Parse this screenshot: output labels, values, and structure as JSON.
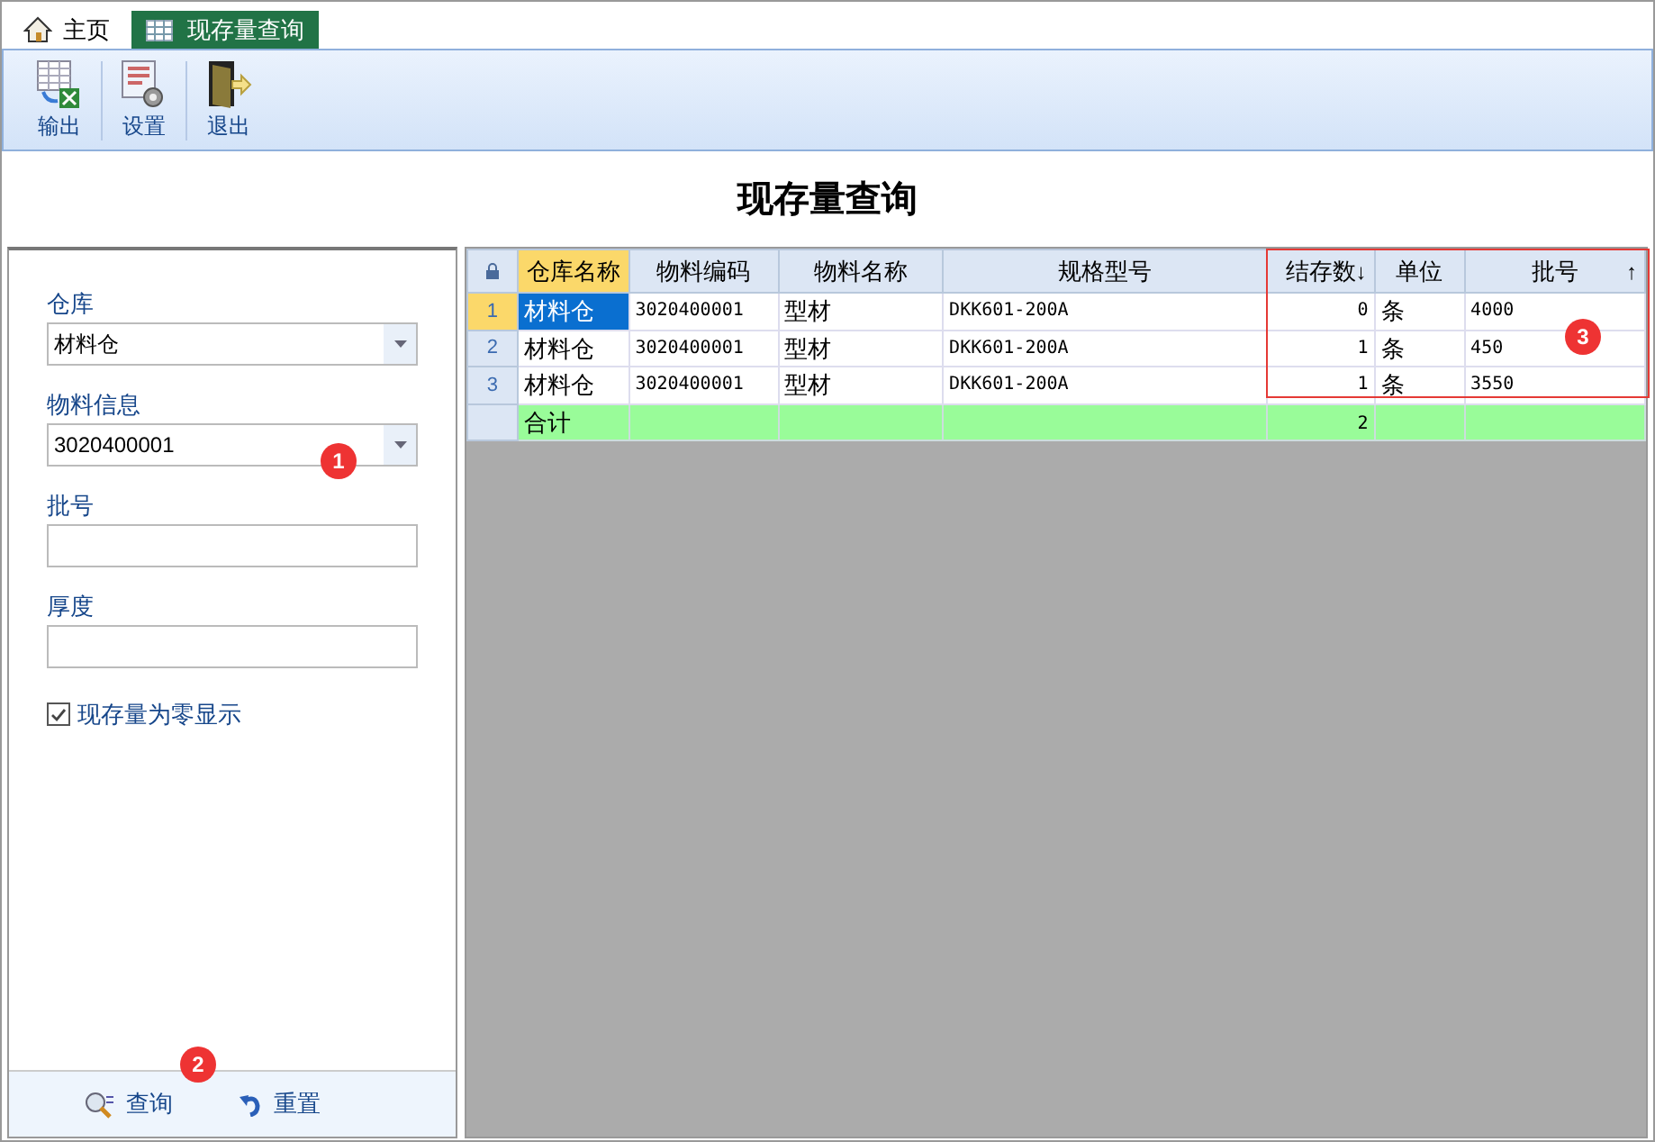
{
  "tabs": [
    {
      "label": "主页",
      "selected": false
    },
    {
      "label": "现存量查询",
      "selected": true
    }
  ],
  "toolbar": [
    {
      "label": "输出"
    },
    {
      "label": "设置"
    },
    {
      "label": "退出"
    }
  ],
  "title": "现存量查询",
  "filters": [
    {
      "kind": "combo",
      "label": "仓库",
      "value": "材料仓"
    },
    {
      "kind": "combo",
      "label": "物料信息",
      "value": "3020400001"
    },
    {
      "kind": "text",
      "label": "批号"
    },
    {
      "kind": "text",
      "label": "厚度"
    }
  ],
  "zero_stock_checkbox": {
    "label": "现存量为零显示",
    "checked": true
  },
  "actions": [
    {
      "label": "查询"
    },
    {
      "label": "重置"
    }
  ],
  "table": {
    "columns": [
      {
        "label": "仓库名称",
        "selected": true
      },
      {
        "label": "物料编码",
        "selected": false
      },
      {
        "label": "物料名称",
        "selected": false
      },
      {
        "label": "规格型号",
        "selected": false
      },
      {
        "label": "结存数",
        "selected": false,
        "sort_mark": "↓"
      },
      {
        "label": "单位",
        "selected": false
      },
      {
        "label": "批号",
        "selected": false,
        "sort_mark": "↑"
      }
    ],
    "rows": [
      {
        "number": "1",
        "selected": true,
        "cells": [
          "材料仓",
          "3020400001",
          "型材",
          "DKK601-200A",
          "0",
          "条",
          "4000"
        ]
      },
      {
        "number": "2",
        "selected": false,
        "cells": [
          "材料仓",
          "3020400001",
          "型材",
          "DKK601-200A",
          "1",
          "条",
          "450"
        ]
      },
      {
        "number": "3",
        "selected": false,
        "cells": [
          "材料仓",
          "3020400001",
          "型材",
          "DKK601-200A",
          "1",
          "条",
          "3550"
        ]
      }
    ],
    "total_row": {
      "label": "合计",
      "stock_total": "2"
    }
  },
  "annotations": [
    "1",
    "2",
    "3"
  ]
}
